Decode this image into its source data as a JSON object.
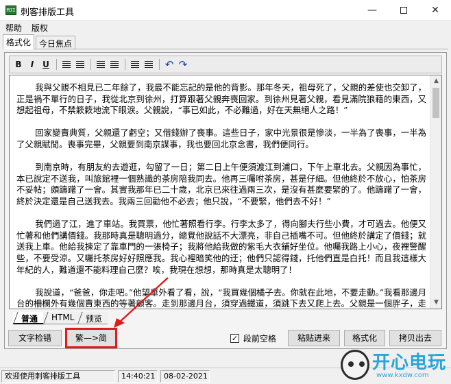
{
  "window": {
    "title": "刺客排版工具",
    "app_icon_text": "MJI",
    "controls": {
      "minimize": "—",
      "close": "✕"
    }
  },
  "menu": {
    "items": [
      "帮助",
      "版权"
    ]
  },
  "top_tabs": [
    {
      "label": "格式化",
      "active": true
    },
    {
      "label": "今日焦点",
      "active": false
    }
  ],
  "toolbar": {
    "bold": "B",
    "italic": "I",
    "underline": "U",
    "undo": "↶",
    "redo": "↷"
  },
  "editor": {
    "paragraphs": [
      "我與父親不相見已二年餘了，我最不能忘記的是他的背影。那年冬天，祖母死了，父親的差使也交卸了，正是禍不單行的日子，我從北京到徐州，打算跟著父親奔喪回家。到徐州見著父親，看見滿院狼藉的東西，又想起祖母，不禁簌簌地流下眼淚。父親說，“事已如此，不必難過，好在天無絕人之路！”",
      "回家變賣典質，父親還了虧空；又借錢辦了喪事。這些日子，家中光景很是慘淡，一半為了喪事，一半為了父親賦閒。喪事完畢，父親要到南京謀事，我也要回北京念書，我們便同行。",
      "到南京時，有朋友約去遊逛，勾留了一日；第二日上午便須渡江到浦口，下午上車北去。父親因為事忙，本已說定不送我，叫旅館裡一個熟識的茶房陪我同去。他再三囑咐茶房，甚是仔細。但他終於不放心，怕茶房不妥帖；頗躊躇了一會。其實我那年已二十歲，北京已來往過兩三次，是沒有甚麼要緊的了。他躊躇了一會，終於決定還是自己送我去。我兩三回勸他不必去；他只說，“不要緊，他們去不好！”",
      "我們過了江，進了車站。我買票，他忙著照看行李。行李太多了，得向腳夫行些小費，才可過去。他便又忙著和他們講價錢。我那時真是聰明過分，總覺他說話不大漂亮，非自己插嘴不可。但他終於講定了價錢；就送我上車。他給我揀定了靠車門的一張椅子；我將他給我做的紫毛大衣鋪好坐位。他囑我路上小心，夜裡警醒些，不要受涼。又囑托茶房好好照應我。我心裡暗笑他的迂；他們只認得錢，托他們直是白托！而且我這樣大年紀的人，難道還不能料理自己麼？唉，我現在想想，那時真是太聰明了！",
      "我說道，“爸爸，你走吧。”他望車外看了看，說，“我買幾個橘子去。你就在此地，不要走動。”我看那邊月台的柵欄外有幾個賣東西的等著顧客。走到那邊月台，須穿過鐵道，須跳下去又爬上去。父親是一個胖子，走過去自然要費事些。我本來要去的，他不肯，只好讓他去。我看見他戴著黑布小帽，穿著黑布大馬褂，深青布棉袍，蹣跚地走到鐵道邊，慢慢探身下去，尚不大難。可是他穿過鐵道，要爬上那邊月台，就不容易了。他用兩手攀著上面，兩腳再向上縮；他肥胖的身子向左微傾，顯出努力的樣子。"
    ]
  },
  "bottom_tabs": [
    {
      "label": "普通",
      "active": true
    },
    {
      "label": "HTML",
      "active": false
    },
    {
      "label": "预览",
      "active": false
    }
  ],
  "buttons": {
    "spell_check": "文字检错",
    "trad_to_simp": "繁—>简",
    "paste_in": "粘贴进来",
    "format": "格式化",
    "copy_out": "拷贝出去"
  },
  "checkbox": {
    "label": "段前空格",
    "checked": true,
    "mark": "✓"
  },
  "statusbar": {
    "message": "欢迎使用刺客排版工具",
    "time": "14:40:21",
    "date": "08-02-2021"
  },
  "watermark": {
    "brand": "开心电玩",
    "url": "www.kxdw.com"
  },
  "colors": {
    "highlight": "#e01b1b",
    "watermark": "#2aa4d8"
  }
}
